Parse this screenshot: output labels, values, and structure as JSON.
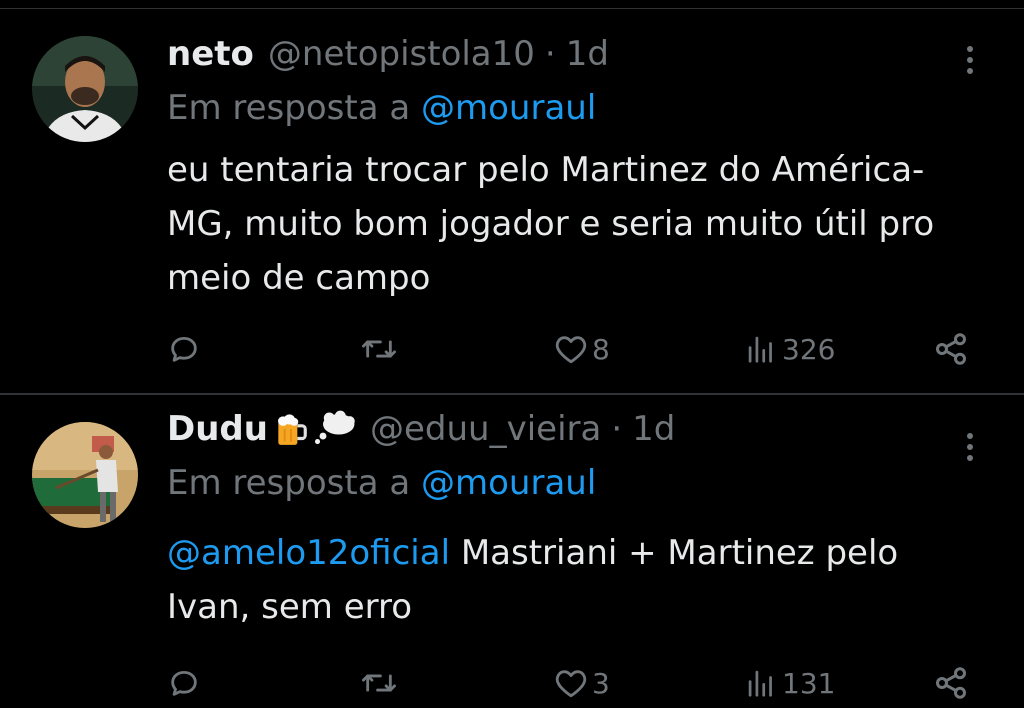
{
  "tweets": [
    {
      "name": "neto",
      "handle": "@netopistola10",
      "separator": "·",
      "time": "1d",
      "reply_prefix": "Em resposta a",
      "reply_to": "@mouraul",
      "mention": "",
      "text": "eu tentaria trocar pelo Martinez do América-MG, muito bom jogador e seria muito útil pro meio de campo",
      "likes": "8",
      "views": "326",
      "icons": [
        "reply-icon",
        "retweet-icon",
        "heart-icon",
        "views-icon",
        "share-icon",
        "more-icon"
      ]
    },
    {
      "name": "Dudu",
      "name_emoji": [
        "beer-icon",
        "thought-balloon-icon"
      ],
      "handle": "@eduu_vieira",
      "separator": "·",
      "time": "1d",
      "reply_prefix": "Em resposta a",
      "reply_to": "@mouraul",
      "mention": "@amelo12oficial",
      "text": "Mastriani + Martinez pelo Ivan, sem erro",
      "likes": "3",
      "views": "131",
      "icons": [
        "reply-icon",
        "retweet-icon",
        "heart-icon",
        "views-icon",
        "share-icon",
        "more-icon"
      ]
    }
  ],
  "colors": {
    "background": "#000000",
    "text": "#e7e9ea",
    "secondary": "#71767b",
    "link": "#1d9bf0",
    "divider": "#2f3336"
  }
}
